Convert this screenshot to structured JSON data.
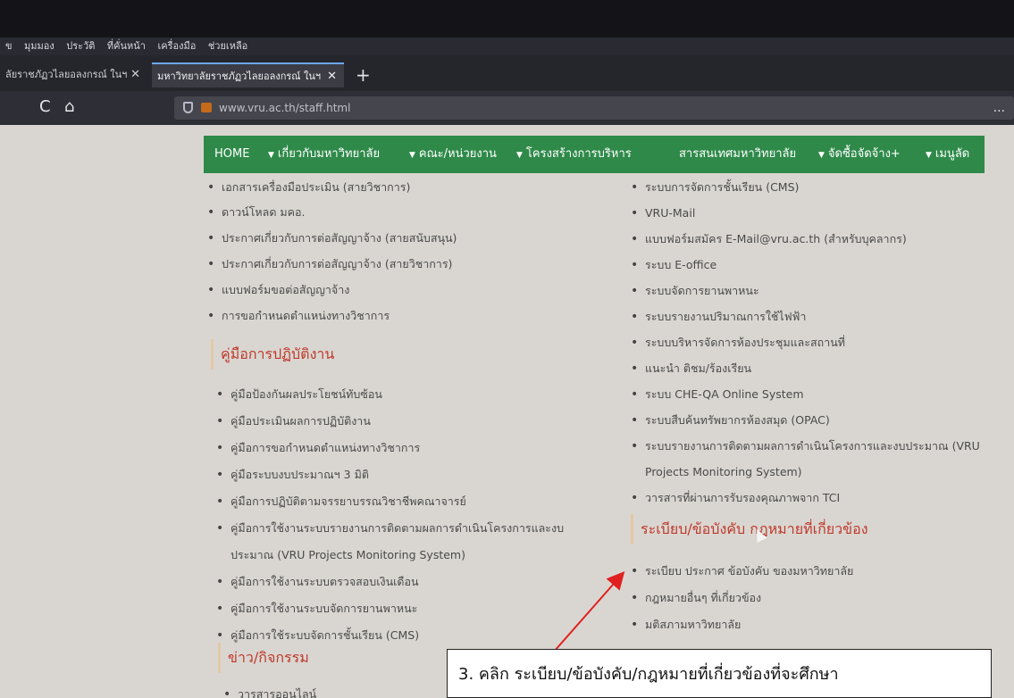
{
  "menubar": [
    "ข",
    "มุมมอง",
    "ประวัติ",
    "ที่คั่นหน้า",
    "เครื่องมือ",
    "ช่วยเหลือ"
  ],
  "tabs": [
    {
      "title": "ลัยราชภัฏวไลยอลงกรณ์ ในฯ",
      "close": "✕"
    },
    {
      "title": "มหาวิทยาลัยราชภัฏวไลยอลงกรณ์ ในฯ",
      "close": "✕"
    }
  ],
  "new_tab": "+",
  "nav": {
    "reload": "C",
    "home": "⌂"
  },
  "url": "www.vru.ac.th/staff.html",
  "url_more": "...",
  "greenbar": {
    "home": "HOME",
    "about": "เกี่ยวกับมหาวิทยาลัย",
    "faculty": "คณะ/หน่วยงาน",
    "structure": "โครงสร้างการบริหาร",
    "it": "สารสนเทศมหาวิทยาลัย",
    "procure": "จัดซื้อจัดจ้าง+",
    "menu": "เมนูลัด"
  },
  "left_top_items": [
    "เอกสารเครื่องมือประเมิน (สายวิชาการ)",
    "ดาวน์โหลด มคอ.",
    "ประกาศเกี่ยวกับการต่อสัญญาจ้าง (สายสนับสนุน)",
    "ประกาศเกี่ยวกับการต่อสัญญาจ้าง (สายวิชาการ)",
    "แบบฟอร์มขอต่อสัญญาจ้าง",
    "การขอกำหนดตำแหน่งทางวิชาการ"
  ],
  "manual_title": "คู่มือการปฏิบัติงาน",
  "manual_items": [
    "คู่มือป้องกันผลประโยชน์ทับซ้อน",
    "คู่มือประเมินผลการปฏิบัติงาน",
    "คู่มือการขอกำหนดตำแหน่งทางวิชาการ",
    "คู่มือระบบงบประมาณฯ 3 มิติ",
    "คู่มือการปฏิบัติตามจรรยาบรรณวิชาชีพคณาจารย์",
    "คู่มือการใช้งานระบบรายงานการติดตามผลการดำเนินโครงการและงบ",
    "ประมาณ (VRU Projects Monitoring System)",
    "คู่มือการใช้งานระบบตรวจสอบเงินเดือน",
    "คู่มือการใช้งานระบบจัดการยานพาหนะ",
    "คู่มือการใช้ระบบจัดการชั้นเรียน (CMS)"
  ],
  "news_title": "ข่าว/กิจกรรม",
  "news_items": [
    "วารสารออนไลน์"
  ],
  "right_items": [
    "ระบบการจัดการชั้นเรียน (CMS)",
    "VRU-Mail",
    "แบบฟอร์มสมัคร E-Mail@vru.ac.th (สำหรับบุคลากร)",
    "ระบบ E-office",
    "ระบบจัดการยานพาหนะ",
    "ระบบรายงานปริมาณการใช้ไฟฟ้า",
    "ระบบบริหารจัดการห้องประชุมและสถานที่",
    "แนะนำ ติชม/ร้องเรียน",
    "ระบบ CHE-QA Online System",
    "ระบบสืบค้นทรัพยากรห้องสมุด (OPAC)",
    "ระบบรายงานการติดตามผลการดำเนินโครงการและงบประมาณ (VRU",
    "Projects Monitoring System)",
    "วารสารที่ผ่านการรับรองคุณภาพจาก TCI"
  ],
  "regulation_title": "ระเบียบ/ข้อบังคับ กฎหมายที่เกี่ยวข้อง",
  "regulation_items": [
    "ระเบียบ ประกาศ ข้อบังคับ ของมหาวิทยาลัย",
    "กฎหมายอื่นๆ ที่เกี่ยวข้อง",
    "มติสภามหาวิทยาลัย"
  ],
  "callout": "3. คลิก ระเบียบ/ข้อบังคับ/กฎหมายที่เกี่ยวข้องที่จะศึกษา",
  "colors": {
    "nav_green": "#2f8a4a",
    "section_red": "#c0392b",
    "arrow": "#e02020"
  }
}
